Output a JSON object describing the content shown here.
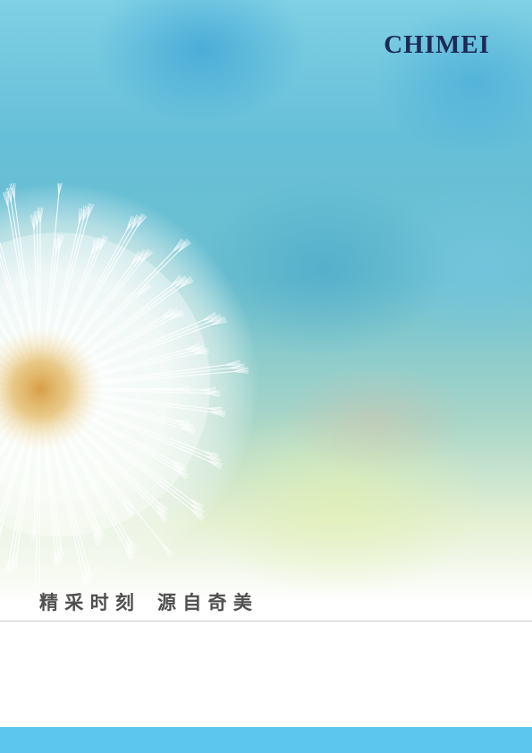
{
  "brand": {
    "logo_text": "CHIMEI",
    "logo_color": "#1d2a55"
  },
  "tagline": {
    "part1": "精 采 时 刻",
    "part2": "源 自 奇 美"
  },
  "colors": {
    "footer_band": "#5cc6ee",
    "divider": "#c8c8c8",
    "tagline_text": "#4f4f4f"
  }
}
